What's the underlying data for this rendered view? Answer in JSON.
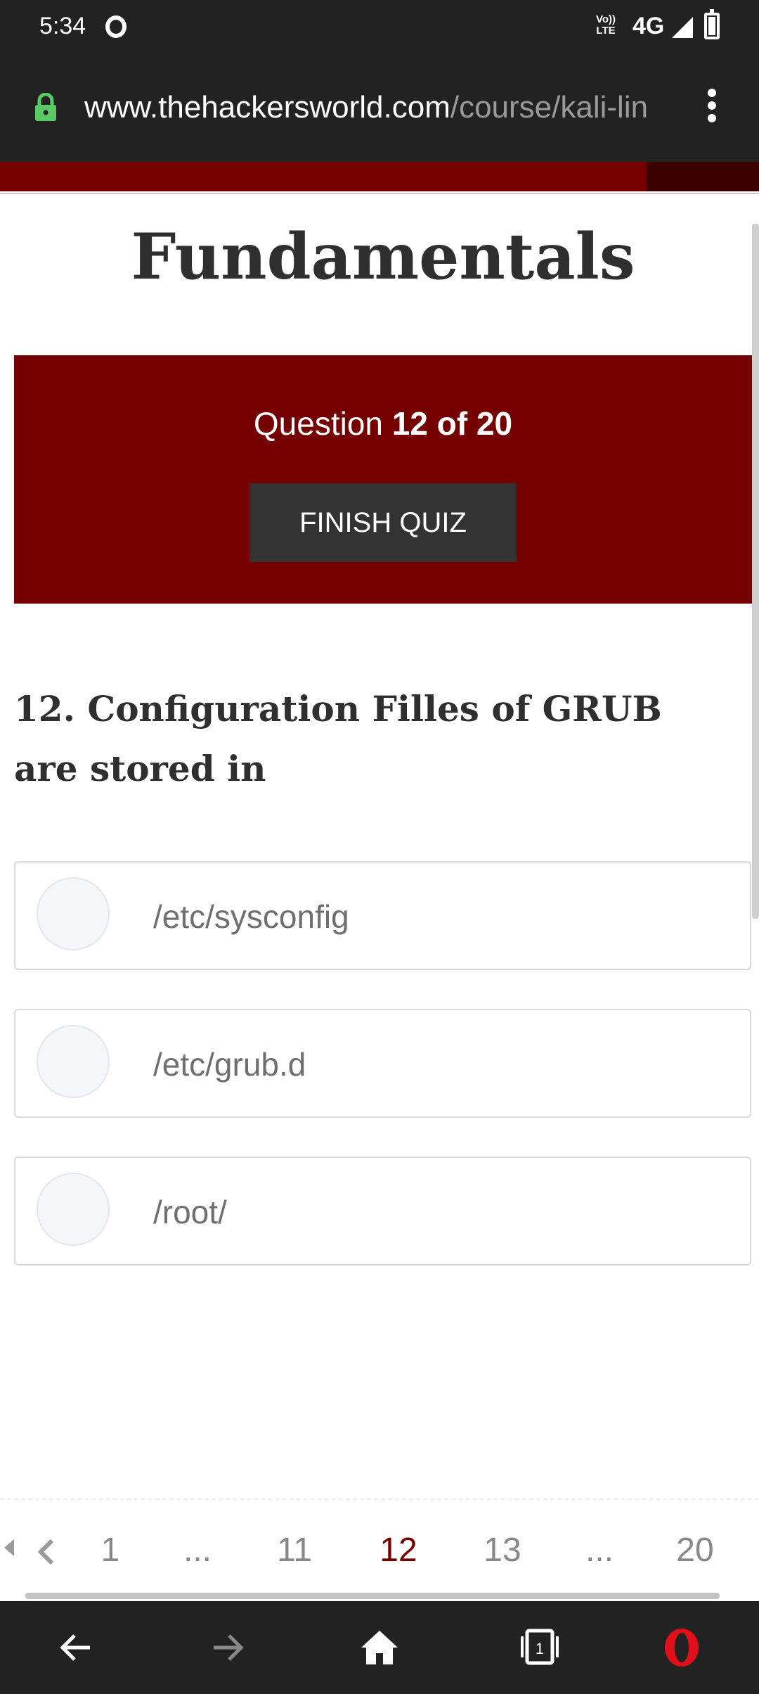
{
  "status_bar": {
    "time": "5:34",
    "volte_line1": "Vo))",
    "volte_line2": "LTE",
    "network": "4G"
  },
  "browser": {
    "url_domain": "www.thehackersworld.com",
    "url_path": "/course/kali-lin",
    "tab_count": "1"
  },
  "page": {
    "title": "Fundamentals",
    "question_prefix": "Question ",
    "question_count": "12 of 20",
    "finish_label": "FINISH QUIZ",
    "question_text": "12. Configuration Filles of GRUB are stored in",
    "options": [
      {
        "label": "/etc/sysconfig"
      },
      {
        "label": "/etc/grub.d"
      },
      {
        "label": "/root/"
      }
    ]
  },
  "pagination": {
    "pages": [
      "1",
      "...",
      "11",
      "12",
      "13",
      "...",
      "20"
    ],
    "current": "12"
  },
  "colors": {
    "brand": "#740000",
    "dark_bar": "#222222",
    "button": "#333333"
  }
}
